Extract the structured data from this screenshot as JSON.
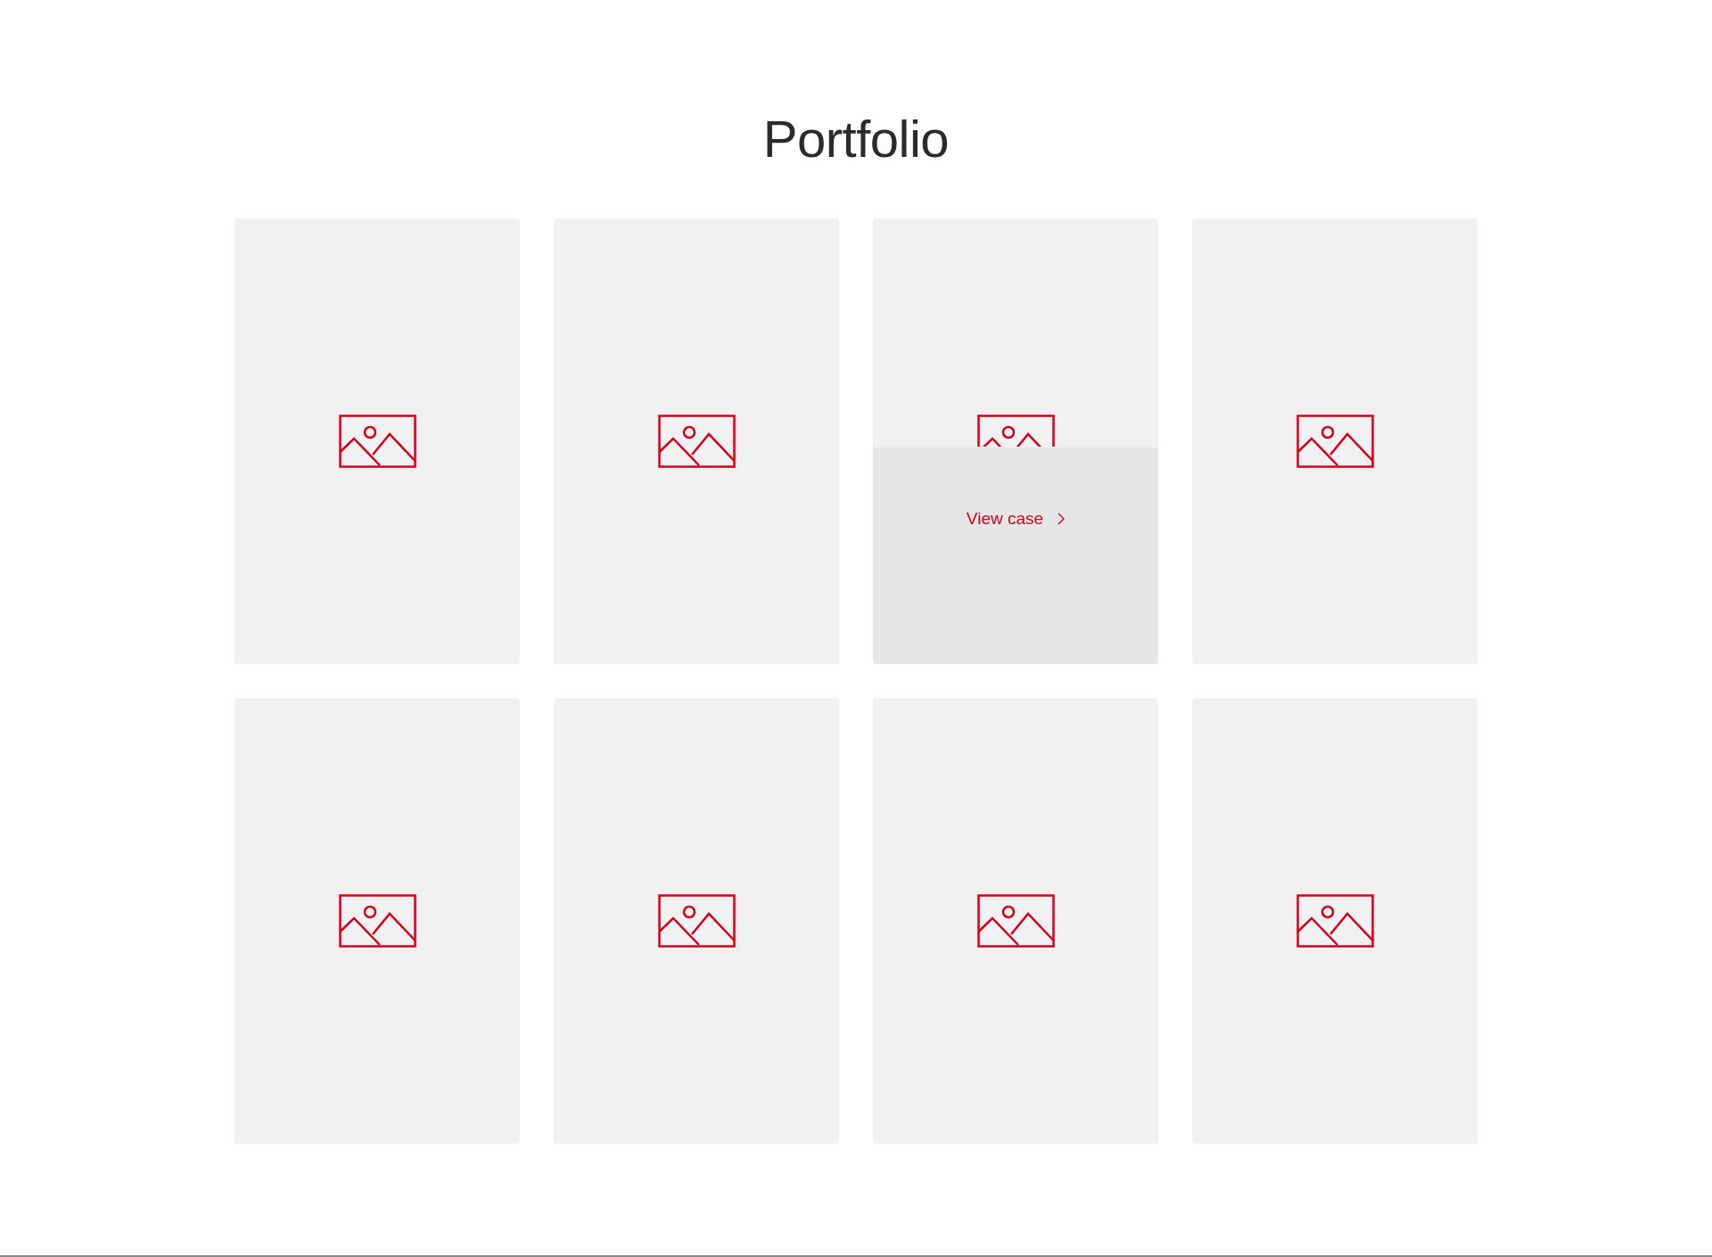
{
  "title": "Portfolio",
  "cards": [
    {
      "hovered": false
    },
    {
      "hovered": false
    },
    {
      "hovered": true,
      "link": "View case"
    },
    {
      "hovered": false
    },
    {
      "hovered": false
    },
    {
      "hovered": false
    },
    {
      "hovered": false
    },
    {
      "hovered": false
    }
  ]
}
